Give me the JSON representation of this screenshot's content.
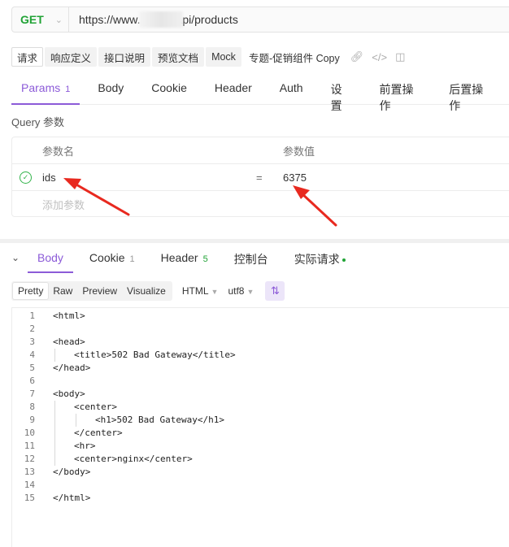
{
  "request": {
    "method": "GET",
    "url": "https://www.          y.com/api/products"
  },
  "doc_tabs": [
    {
      "label": "请求",
      "active": true
    },
    {
      "label": "响应定义",
      "active": false
    },
    {
      "label": "接口说明",
      "active": false
    },
    {
      "label": "预览文档",
      "active": false
    },
    {
      "label": "Mock",
      "active": false
    },
    {
      "label": "专题-促销组件 Copy",
      "active": false
    }
  ],
  "request_tabs": [
    {
      "label": "Params",
      "count": "1",
      "active": true
    },
    {
      "label": "Body",
      "count": "",
      "active": false
    },
    {
      "label": "Cookie",
      "count": "",
      "active": false
    },
    {
      "label": "Header",
      "count": "",
      "active": false
    },
    {
      "label": "Auth",
      "count": "",
      "active": false
    },
    {
      "label": "设置",
      "count": "",
      "active": false
    },
    {
      "label": "前置操作",
      "count": "",
      "active": false
    },
    {
      "label": "后置操作",
      "count": "",
      "active": false
    }
  ],
  "query": {
    "title": "Query 参数",
    "header_name": "参数名",
    "header_value": "参数值",
    "params": [
      {
        "name": "ids",
        "value": "6375",
        "enabled": true
      }
    ],
    "add_placeholder": "添加参数",
    "equals": "="
  },
  "response_tabs": [
    {
      "label": "Body",
      "count": "",
      "active": true
    },
    {
      "label": "Cookie",
      "count": "1",
      "active": false
    },
    {
      "label": "Header",
      "count": "5",
      "active": false
    },
    {
      "label": "控制台",
      "count": "",
      "active": false
    },
    {
      "label": "实际请求",
      "count": "",
      "active": false
    }
  ],
  "view_modes": [
    "Pretty",
    "Raw",
    "Preview",
    "Visualize"
  ],
  "format_select": "HTML",
  "encoding_select": "utf8",
  "code_lines": [
    {
      "n": "1",
      "indent": 0,
      "text": "<html>"
    },
    {
      "n": "2",
      "indent": 0,
      "text": ""
    },
    {
      "n": "3",
      "indent": 0,
      "text": "<head>"
    },
    {
      "n": "4",
      "indent": 1,
      "text": "<title>502 Bad Gateway</title>"
    },
    {
      "n": "5",
      "indent": 0,
      "text": "</head>"
    },
    {
      "n": "6",
      "indent": 0,
      "text": ""
    },
    {
      "n": "7",
      "indent": 0,
      "text": "<body>"
    },
    {
      "n": "8",
      "indent": 1,
      "text": "<center>"
    },
    {
      "n": "9",
      "indent": 2,
      "text": "<h1>502 Bad Gateway</h1>"
    },
    {
      "n": "10",
      "indent": 1,
      "text": "</center>"
    },
    {
      "n": "11",
      "indent": 1,
      "text": "<hr>"
    },
    {
      "n": "12",
      "indent": 1,
      "text": "<center>nginx</center>"
    },
    {
      "n": "13",
      "indent": 0,
      "text": "</body>"
    },
    {
      "n": "14",
      "indent": 0,
      "text": ""
    },
    {
      "n": "15",
      "indent": 0,
      "text": "</html>"
    }
  ],
  "colors": {
    "accent": "#8c5bd8",
    "method_get": "#21a336",
    "annotation_arrow": "#e8291f"
  }
}
